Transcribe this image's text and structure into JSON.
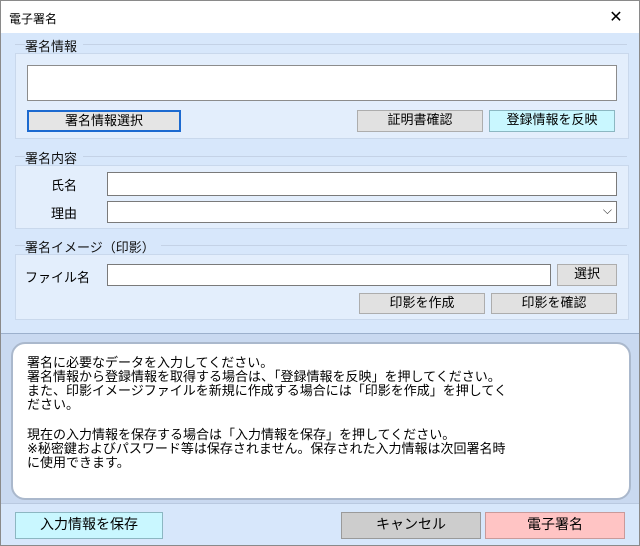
{
  "window": {
    "title": "電子署名",
    "close": "✕"
  },
  "sign_info": {
    "group_label": "署名情報",
    "field_value": "",
    "select_button": "署名情報選択",
    "cert_button": "証明書確認",
    "reflect_button": "登録情報を反映"
  },
  "sign_content": {
    "group_label": "署名内容",
    "name_label": "氏名",
    "name_value": "",
    "reason_label": "理由",
    "reason_value": "",
    "reason_chevron": "⌵"
  },
  "sign_image": {
    "group_label": "署名イメージ（印影）",
    "file_label": "ファイル名",
    "file_value": "",
    "browse_button": "選択",
    "create_button": "印影を作成",
    "confirm_button": "印影を確認"
  },
  "message": {
    "lines": [
      "署名に必要なデータを入力してください。",
      "署名情報から登録情報を取得する場合は、「登録情報を反映」を押してください。",
      "また、印影イメージファイルを新規に作成する場合には「印影を作成」を押してく",
      "ださい。",
      "現在の入力情報を保存する場合は「入力情報を保存」を押してください。",
      "※秘密鍵およびパスワード等は保存されません。保存された入力情報は次回署名時",
      "に使用できます。"
    ]
  },
  "footer": {
    "save_button": "入力情報を保存",
    "cancel_button": "キャンセル",
    "sign_button": "電子署名"
  },
  "colors": {
    "panel_bg": "#d7e7fb",
    "save_bg": "#c9f7ff",
    "cancel_bg": "#cdcdcd",
    "sign_bg": "#ffc4c4"
  }
}
